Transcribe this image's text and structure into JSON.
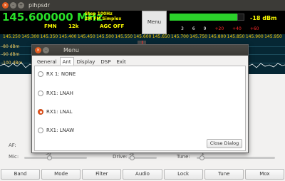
{
  "window": {
    "title": "pihpsdr"
  },
  "vfo": {
    "frequency": "145.600000 MHz",
    "mode": "FMN",
    "bandwidth": "12k",
    "agc": "AGC OFF",
    "step": "Step 100Hz",
    "duplex": "2M FM Simplex"
  },
  "menu_button": {
    "label": "Menu"
  },
  "smeter": {
    "level": "-18 dBm",
    "scale": [
      "3",
      "6",
      "9",
      "+20",
      "+40",
      "+60"
    ],
    "level_fraction": 0.9
  },
  "spectrum": {
    "freq_ticks": [
      "145.250",
      "145.300",
      "145.350",
      "145.400",
      "145.450",
      "145.500",
      "145.550",
      "145.600",
      "145.650",
      "145.700",
      "145.750",
      "145.800",
      "145.850",
      "145.900",
      "145.950"
    ],
    "db_labels": [
      "-80 dBm",
      "-90 dBm",
      "-100 dBm"
    ]
  },
  "dialog": {
    "title": "Menu",
    "tabs": [
      "General",
      "Ant",
      "Display",
      "DSP",
      "Exit"
    ],
    "active_tab": "Ant",
    "options": [
      "RX 1: NONE",
      "RX1: LNAH",
      "RX1: LNAL",
      "RX1: LNAW"
    ],
    "selected_option": "RX1: LNAL",
    "close_label": "Close Dialog"
  },
  "controls": {
    "af_label": "AF:",
    "mic_label": "Mic:",
    "mic_value": "38",
    "drive_label": "Drive:",
    "drive_value": "32",
    "tune_label": "Tune:",
    "tune_value": "2"
  },
  "function_buttons": [
    "Band",
    "Mode",
    "Filter",
    "Audio",
    "Lock",
    "Tune",
    "Mox"
  ],
  "colors": {
    "frequency": "#29e129",
    "vfo_text": "#ffff00",
    "spectrum_bg": "#062734",
    "radio_selected": "#e95420"
  }
}
